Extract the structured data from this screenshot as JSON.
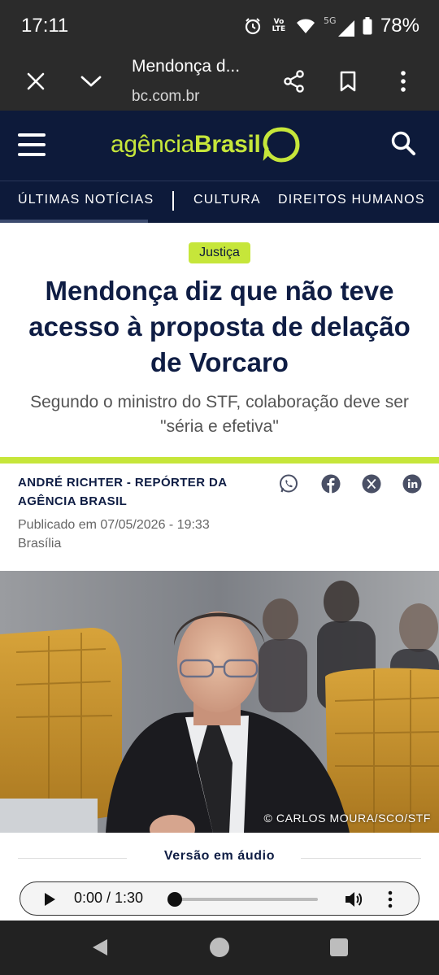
{
  "status_bar": {
    "time": "17:11",
    "volte_line1": "Vo",
    "volte_line2": "LTE",
    "network": "5G",
    "battery": "78%"
  },
  "browser": {
    "page_title": "Mendonça d...",
    "url": "bc.com.br"
  },
  "site": {
    "logo_light": "agência",
    "logo_bold": "Brasil",
    "accent_color": "#c6e63a",
    "header_color": "#0d1a3a"
  },
  "nav": {
    "items": [
      {
        "label": "ÚLTIMAS NOTÍCIAS"
      },
      {
        "label": "CULTURA"
      },
      {
        "label": "DIREITOS HUMANOS"
      }
    ]
  },
  "article": {
    "tag": "Justiça",
    "headline": "Mendonça diz que não teve acesso à proposta de delação de Vorcaro",
    "subtitle": "Segundo o ministro do STF, colaboração deve ser \"séria e efetiva\"",
    "author": "ANDRÉ RICHTER - REPÓRTER DA AGÊNCIA BRASIL",
    "published": "Publicado em 07/05/2026 - 19:33",
    "location": "Brasília",
    "share_icons": [
      "whatsapp-icon",
      "facebook-icon",
      "x-icon",
      "linkedin-icon"
    ],
    "photo_credit": "© CARLOS MOURA/SCO/STF"
  },
  "audio": {
    "label": "Versão em áudio",
    "time": "0:00 / 1:30",
    "progress": 0
  }
}
